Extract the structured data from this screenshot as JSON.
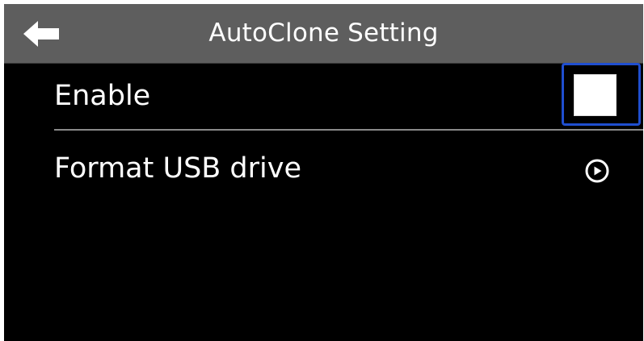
{
  "header": {
    "title": "AutoClone Setting",
    "back_icon": "left-arrow-icon"
  },
  "settings": {
    "enable": {
      "label": "Enable",
      "checked": false
    },
    "format": {
      "label": "Format USB drive",
      "icon": "circle-play-arrow-icon"
    }
  },
  "colors": {
    "header_bg": "#5e5e5e",
    "screen_bg": "#000000",
    "text": "#ffffff",
    "focus": "#1f4ecf"
  }
}
